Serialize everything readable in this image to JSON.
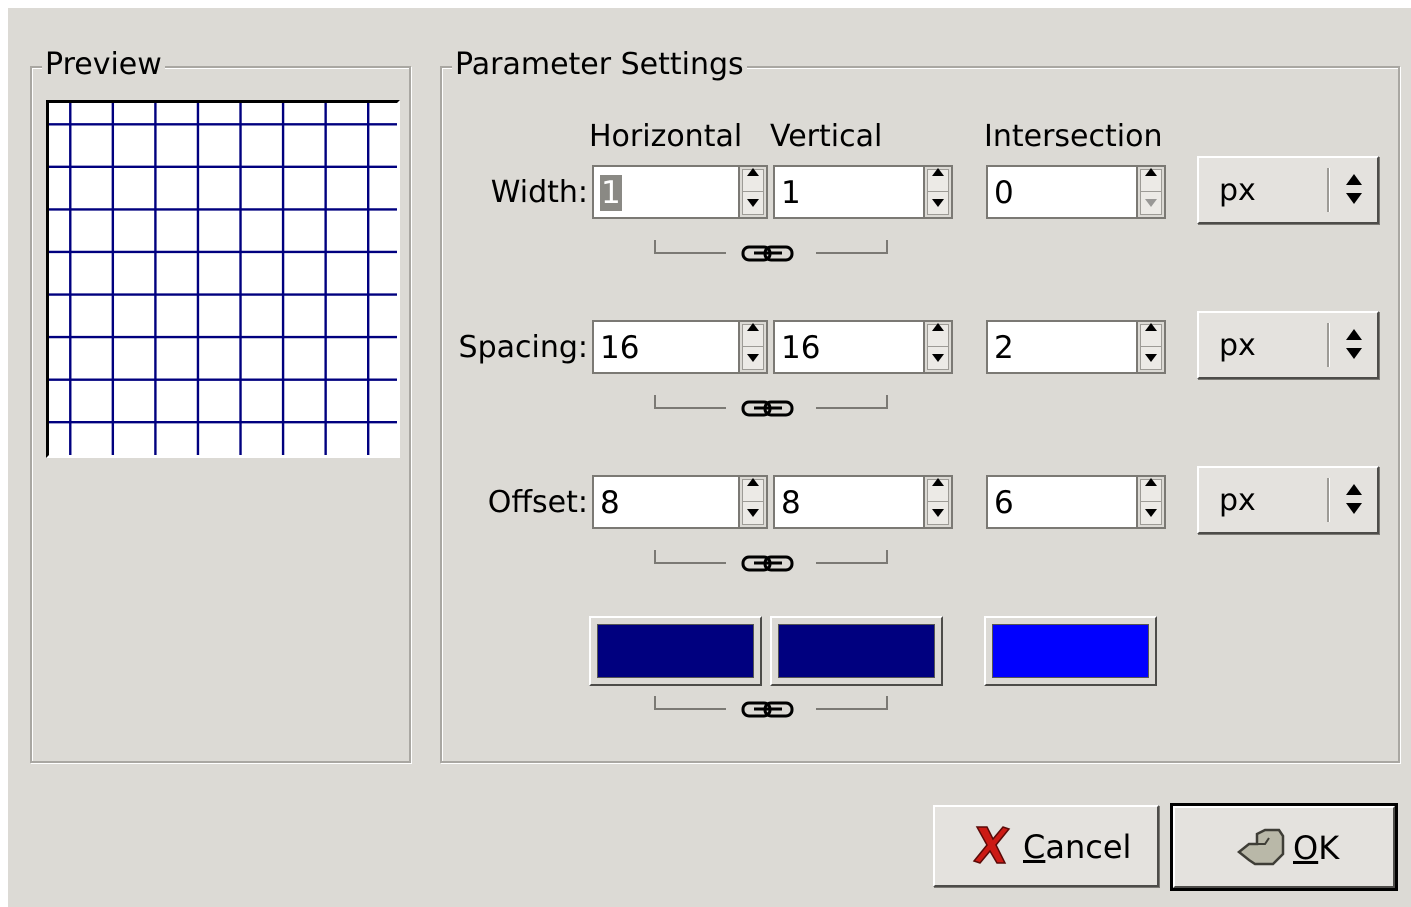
{
  "preview": {
    "title": "Preview",
    "grid_color": "#00007f"
  },
  "params": {
    "title": "Parameter Settings",
    "columns": {
      "horizontal": "Horizontal",
      "vertical": "Vertical",
      "intersection": "Intersection"
    },
    "rows": {
      "width": {
        "label": "Width:",
        "horizontal": "1",
        "vertical": "1",
        "intersection": "0",
        "unit": "px"
      },
      "spacing": {
        "label": "Spacing:",
        "horizontal": "16",
        "vertical": "16",
        "intersection": "2",
        "unit": "px"
      },
      "offset": {
        "label": "Offset:",
        "horizontal": "8",
        "vertical": "8",
        "intersection": "6",
        "unit": "px"
      }
    },
    "colors": {
      "horizontal": "#00007f",
      "vertical": "#00007f",
      "intersection": "#0000ff"
    }
  },
  "buttons": {
    "cancel": {
      "mnemonic": "C",
      "rest": "ancel"
    },
    "ok": {
      "mnemonic": "O",
      "rest": "K"
    }
  }
}
